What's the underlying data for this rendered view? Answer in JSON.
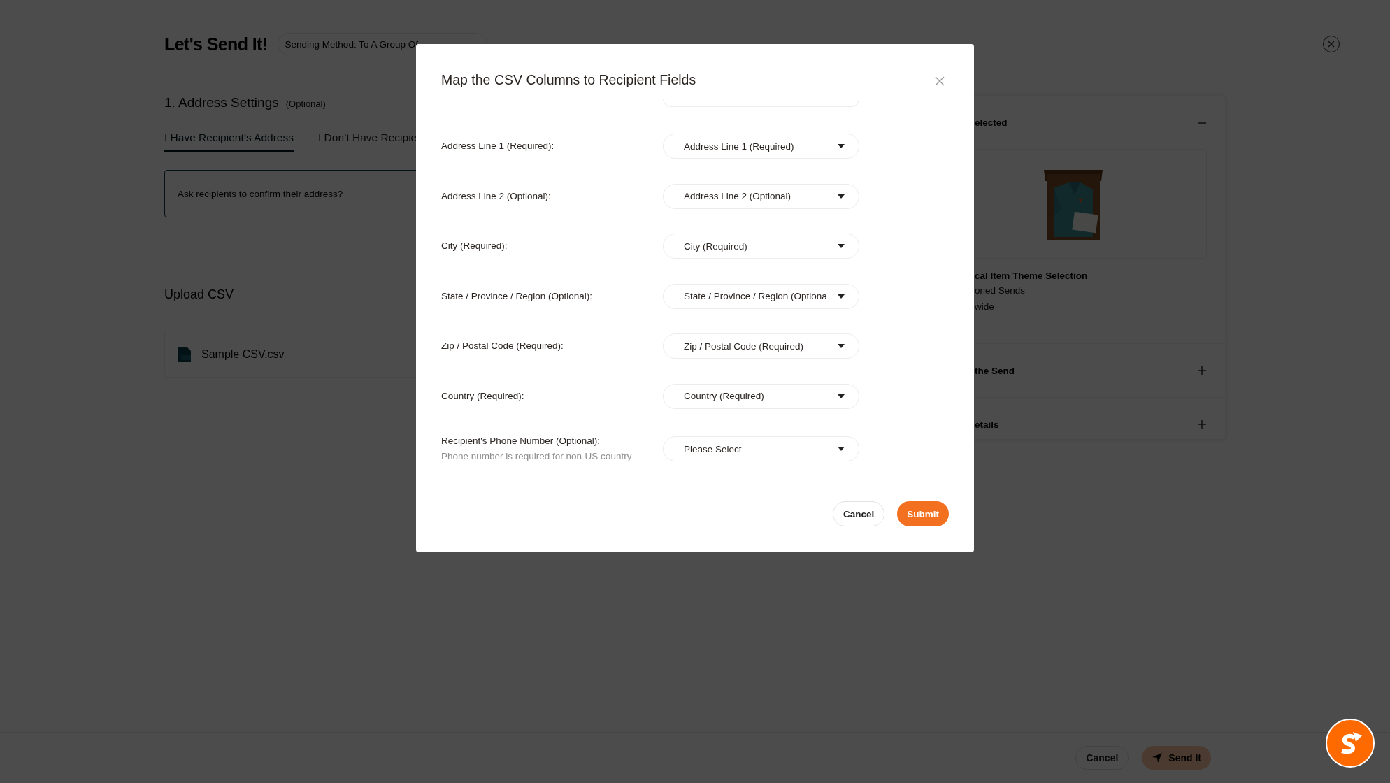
{
  "page": {
    "title": "Let's Send It!",
    "sending_method": "Sending Method: To A Group Of",
    "section_title": "1. Address Settings",
    "section_hint": "(Optional)",
    "tabs": [
      {
        "label": "I Have Recipient’s Address",
        "selected": true
      },
      {
        "label": "I Don’t Have Recipie",
        "selected": false
      }
    ],
    "confirm_question": "Ask recipients to confirm their address?",
    "upload_title": "Upload CSV",
    "file_name": "Sample CSV.csv"
  },
  "summary_panel": {
    "sections": [
      {
        "title": "elected",
        "expanded": true
      },
      {
        "title": "the Send",
        "expanded": false
      },
      {
        "title": "etails",
        "expanded": false
      }
    ],
    "item_title": "cal Item Theme Selection",
    "item_lines": [
      "oried Sends",
      "wide"
    ]
  },
  "footer": {
    "buttons": [
      {
        "label": "Cancel",
        "kind": "secondary"
      },
      {
        "label": "Send It",
        "kind": "primary",
        "disabled": true
      }
    ]
  },
  "dialog": {
    "title": "Map the CSV Columns to Recipient Fields",
    "fields": [
      {
        "label": "Address Line 1 (Required):",
        "value": "Address Line 1 (Required)"
      },
      {
        "label": "Address Line 2 (Optional):",
        "value": "Address Line 2 (Optional)"
      },
      {
        "label": "City (Required):",
        "value": "City (Required)"
      },
      {
        "label": "State / Province / Region (Optional):",
        "value": "State / Province / Region (Optiona"
      },
      {
        "label": "Zip / Postal Code (Required):",
        "value": "Zip / Postal Code (Required)"
      },
      {
        "label": "Country (Required):",
        "value": "Country (Required)"
      },
      {
        "label": "Recipient's Phone Number (Optional):",
        "hint": "Phone number is required for non-US country",
        "placeholder": "Please Select"
      }
    ],
    "buttons": [
      {
        "label": "Cancel",
        "kind": "secondary"
      },
      {
        "label": "Submit",
        "kind": "primary"
      }
    ]
  }
}
